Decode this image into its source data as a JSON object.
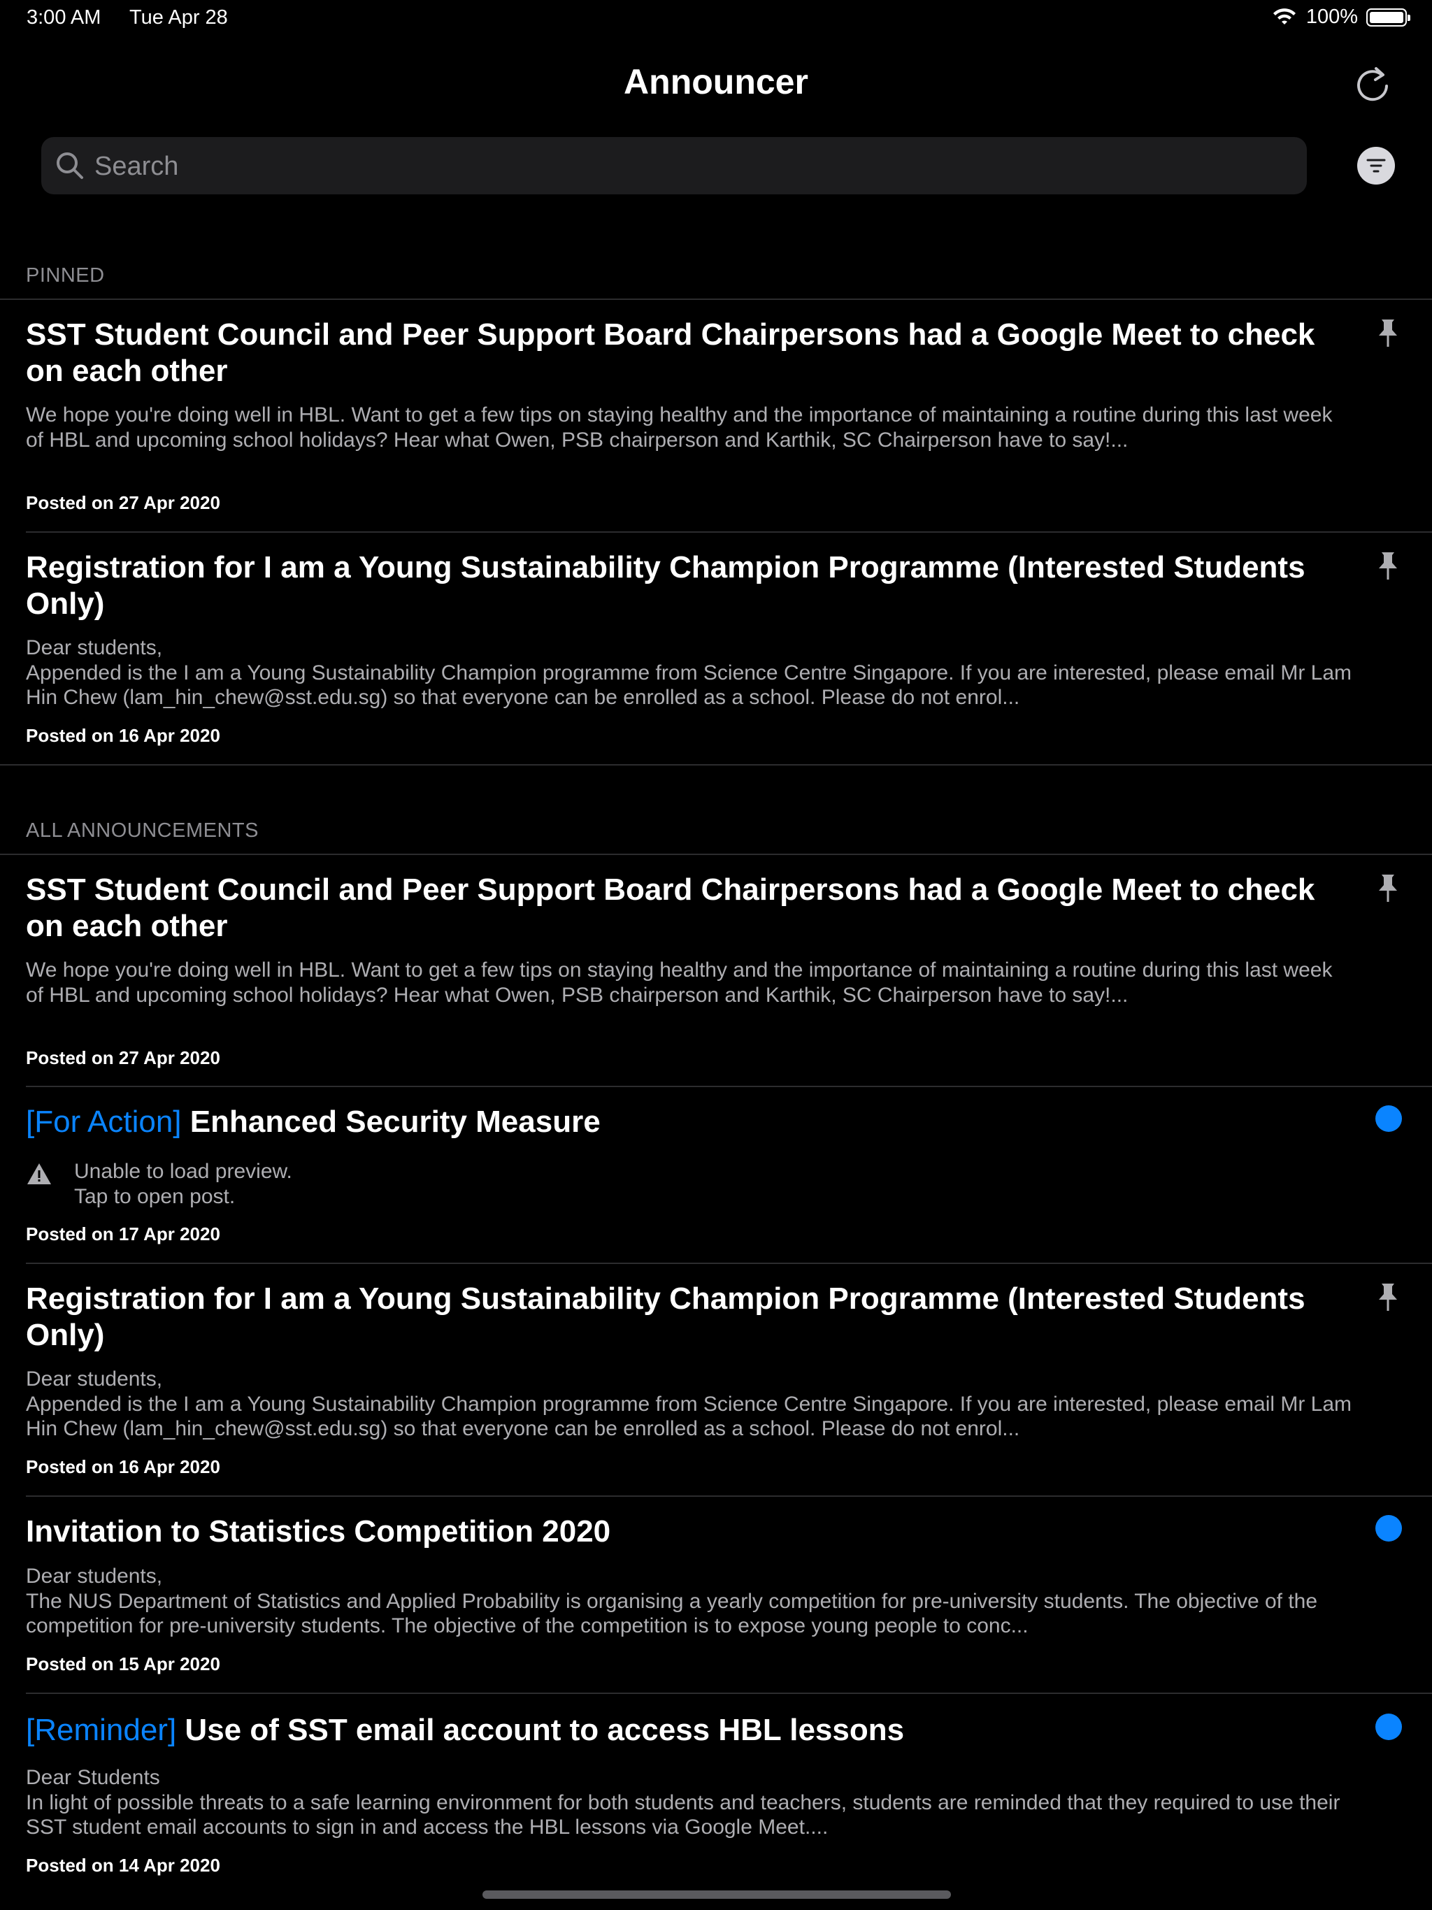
{
  "status_bar": {
    "time": "3:00 AM",
    "date": "Tue Apr 28",
    "battery": "100%"
  },
  "nav": {
    "title": "Announcer"
  },
  "search": {
    "placeholder": "Search"
  },
  "sections": {
    "pinned": "PINNED",
    "all": "ALL ANNOUNCEMENTS"
  },
  "pinned": [
    {
      "title": "SST Student Council and Peer Support Board Chairpersons had a Google Meet to check on each other",
      "preview": "We hope you're doing well in HBL. Want to get a few tips on staying healthy and the importance of maintaining a routine during this last week of HBL and upcoming school holidays? Hear what Owen, PSB chairperson and Karthik, SC Chairperson have to say!...",
      "date": "Posted on 27 Apr 2020"
    },
    {
      "title": "Registration for I am a Young Sustainability Champion Programme (Interested Students Only)",
      "preview": "Dear students,\nAppended is the I am a Young Sustainability Champion programme from Science Centre Singapore. If you are interested, please email Mr Lam Hin Chew (lam_hin_chew@sst.edu.sg) so that everyone can be enrolled as a school. Please do not enrol...",
      "date": "Posted on 16 Apr 2020"
    }
  ],
  "all": [
    {
      "title": "SST Student Council and Peer Support Board Chairpersons had a Google Meet to check on each other",
      "preview": "We hope you're doing well in HBL. Want to get a few tips on staying healthy and the importance of maintaining a routine during this last week of HBL and upcoming school holidays? Hear what Owen, PSB chairperson and Karthik, SC Chairperson have to say!...",
      "date": "Posted on 27 Apr 2020"
    },
    {
      "tag": "[For Action]",
      "title": "Enhanced Security Measure",
      "warning": "Unable to load preview.\nTap to open post.",
      "date": "Posted on 17 Apr 2020"
    },
    {
      "title": "Registration for I am a Young Sustainability Champion Programme (Interested Students Only)",
      "preview": "Dear students,\nAppended is the I am a Young Sustainability Champion programme from Science Centre Singapore. If you are interested, please email Mr Lam Hin Chew (lam_hin_chew@sst.edu.sg) so that everyone can be enrolled as a school. Please do not enrol...",
      "date": "Posted on 16 Apr 2020"
    },
    {
      "title": "Invitation to Statistics Competition 2020",
      "preview": "Dear students,\nThe NUS Department of Statistics and Applied Probability is organising a yearly competition for pre-university students. The objective of the competition for pre-university students. The objective of the competition is to expose young people to conc...",
      "date": "Posted on 15 Apr 2020"
    },
    {
      "tag": "[Reminder]",
      "title": "Use of SST email account to access HBL lessons",
      "preview": "Dear Students\nIn light of possible threats to a safe learning environment for both students and teachers, students are reminded that they required to use their SST student email accounts to sign in and access the HBL lessons via Google Meet....",
      "date": "Posted on 14 Apr 2020"
    }
  ],
  "colors": {
    "background": "#000000",
    "accent": "#0a84ff",
    "secondary_text": "#aeaeb2",
    "separator": "#2c2c2e",
    "search_field": "#1c1c1e"
  },
  "icons": {
    "refresh": "refresh-icon",
    "search": "search-icon",
    "filter": "filter-icon",
    "pin": "pin-icon",
    "unread": "unread-dot",
    "warning": "warning-icon",
    "wifi": "wifi-icon",
    "battery": "battery-icon"
  }
}
